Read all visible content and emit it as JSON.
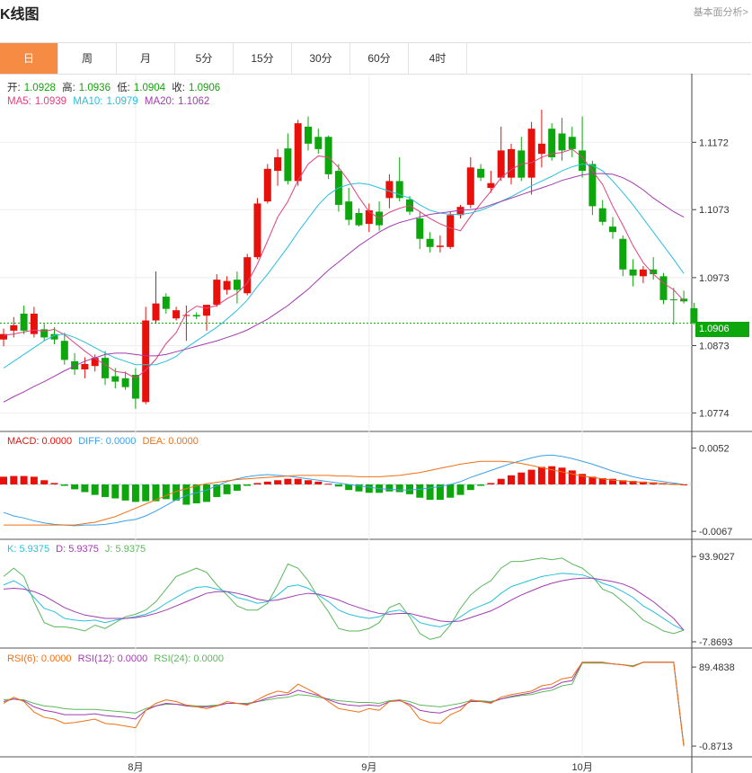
{
  "header": {
    "title": "K线图",
    "fundamental_link": "基本面分析>"
  },
  "tabs": [
    {
      "label": "日",
      "active": true
    },
    {
      "label": "周",
      "active": false
    },
    {
      "label": "月",
      "active": false
    },
    {
      "label": "5分",
      "active": false
    },
    {
      "label": "15分",
      "active": false
    },
    {
      "label": "30分",
      "active": false
    },
    {
      "label": "60分",
      "active": false
    },
    {
      "label": "4时",
      "active": false
    }
  ],
  "ohlc": {
    "open_label": "开:",
    "open": "1.0928",
    "high_label": "高:",
    "high": "1.0936",
    "low_label": "低:",
    "low": "1.0904",
    "close_label": "收:",
    "close": "1.0906"
  },
  "ma": {
    "ma5_label": "MA5:",
    "ma5": "1.0939",
    "ma10_label": "MA10:",
    "ma10": "1.0979",
    "ma20_label": "MA20:",
    "ma20": "1.1062"
  },
  "macd": {
    "macd_label": "MACD: 0.0000",
    "diff_label": "DIFF: 0.0000",
    "dea_label": "DEA: 0.0000"
  },
  "kdj": {
    "k_label": "K: 5.9375",
    "d_label": "D: 5.9375",
    "j_label": "J: 5.9375"
  },
  "rsi": {
    "rsi6_label": "RSI(6): 0.0000",
    "rsi12_label": "RSI(12): 0.0000",
    "rsi24_label": "RSI(24): 0.0000"
  },
  "current_price": "1.0906",
  "colors": {
    "up": "#e8100a",
    "down": "#0da70d",
    "ma5": "#e0407f",
    "ma10": "#28c0dc",
    "ma20": "#a33bb0",
    "diff": "#3ba0e8",
    "dea": "#f07014",
    "rsi6": "#f07014",
    "rsi12": "#a33bb0",
    "rsi24": "#5cb85c",
    "tab_active": "#f68b43"
  },
  "chart_data": {
    "type": "candlestick",
    "price_axis_ticks": [
      "1.1172",
      "1.1073",
      "1.0973",
      "1.0873",
      "1.0774"
    ],
    "price_range": [
      1.076,
      1.122
    ],
    "x_tick_labels": [
      {
        "label": "8月",
        "index": 13
      },
      {
        "label": "9月",
        "index": 36
      },
      {
        "label": "10月",
        "index": 57
      }
    ],
    "candles": [
      [
        1.0882,
        1.0898,
        1.0872,
        1.089
      ],
      [
        1.0895,
        1.0915,
        1.0885,
        1.0903
      ],
      [
        1.092,
        1.0932,
        1.089,
        1.0895
      ],
      [
        1.089,
        1.093,
        1.0885,
        1.092
      ],
      [
        1.0897,
        1.0905,
        1.088,
        1.0885
      ],
      [
        1.089,
        1.09,
        1.0875,
        1.0882
      ],
      [
        1.088,
        1.0892,
        1.0845,
        1.0852
      ],
      [
        1.085,
        1.0862,
        1.083,
        1.0838
      ],
      [
        1.0838,
        1.0856,
        1.0825,
        1.0846
      ],
      [
        1.0843,
        1.086,
        1.0835,
        1.0855
      ],
      [
        1.0855,
        1.0865,
        1.0815,
        1.0825
      ],
      [
        1.0828,
        1.084,
        1.081,
        1.082
      ],
      [
        1.0825,
        1.0835,
        1.0808,
        1.0812
      ],
      [
        1.083,
        1.084,
        1.078,
        1.0795
      ],
      [
        1.079,
        1.093,
        1.0787,
        1.091
      ],
      [
        1.091,
        1.0982,
        1.0905,
        1.0935
      ],
      [
        1.0945,
        1.095,
        1.092,
        1.0927
      ],
      [
        1.0913,
        1.093,
        1.091,
        1.0925
      ],
      [
        1.0917,
        1.0932,
        1.088,
        1.0918
      ],
      [
        1.0918,
        1.0922,
        1.0912,
        1.0916
      ],
      [
        1.0917,
        1.093,
        1.0895,
        1.0933
      ],
      [
        1.0933,
        1.0978,
        1.093,
        1.097
      ],
      [
        1.0955,
        1.0975,
        1.0948,
        1.0968
      ],
      [
        1.097,
        1.0982,
        1.0935,
        1.0955
      ],
      [
        1.095,
        1.1008,
        1.0947,
        1.1003
      ],
      [
        1.1003,
        1.109,
        1.1,
        1.1082
      ],
      [
        1.1085,
        1.114,
        1.1082,
        1.1133
      ],
      [
        1.113,
        1.1162,
        1.1108,
        1.115
      ],
      [
        1.1163,
        1.1185,
        1.111,
        1.1115
      ],
      [
        1.1115,
        1.1205,
        1.1108,
        1.12
      ],
      [
        1.1195,
        1.121,
        1.116,
        1.117
      ],
      [
        1.118,
        1.1192,
        1.1155,
        1.1162
      ],
      [
        1.118,
        1.1182,
        1.1118,
        1.1125
      ],
      [
        1.113,
        1.114,
        1.107,
        1.108
      ],
      [
        1.1085,
        1.1105,
        1.105,
        1.1058
      ],
      [
        1.1068,
        1.1075,
        1.1048,
        1.105
      ],
      [
        1.1052,
        1.1082,
        1.104,
        1.1072
      ],
      [
        1.107,
        1.1085,
        1.1042,
        1.105
      ],
      [
        1.109,
        1.1125,
        1.1075,
        1.1115
      ],
      [
        1.1115,
        1.115,
        1.1085,
        1.109
      ],
      [
        1.1088,
        1.1093,
        1.1065,
        1.107
      ],
      [
        1.106,
        1.107,
        1.1015,
        1.103
      ],
      [
        1.103,
        1.104,
        1.101,
        1.1018
      ],
      [
        1.1018,
        1.1035,
        1.101,
        1.102
      ],
      [
        1.1018,
        1.107,
        1.1015,
        1.1065
      ],
      [
        1.1065,
        1.108,
        1.106,
        1.1077
      ],
      [
        1.108,
        1.115,
        1.1075,
        1.1135
      ],
      [
        1.1133,
        1.114,
        1.1115,
        1.112
      ],
      [
        1.1105,
        1.113,
        1.1098,
        1.1112
      ],
      [
        1.112,
        1.1195,
        1.1115,
        1.116
      ],
      [
        1.112,
        1.117,
        1.111,
        1.1162
      ],
      [
        1.116,
        1.118,
        1.1115,
        1.112
      ],
      [
        1.112,
        1.1202,
        1.1095,
        1.1192
      ],
      [
        1.1155,
        1.122,
        1.1135,
        1.117
      ],
      [
        1.1192,
        1.12,
        1.1145,
        1.115
      ],
      [
        1.1185,
        1.1208,
        1.1145,
        1.116
      ],
      [
        1.118,
        1.1195,
        1.115,
        1.1162
      ],
      [
        1.116,
        1.121,
        1.112,
        1.113
      ],
      [
        1.114,
        1.1145,
        1.1065,
        1.1078
      ],
      [
        1.1075,
        1.1087,
        1.105,
        1.1055
      ],
      [
        1.1048,
        1.1062,
        1.103,
        1.104
      ],
      [
        1.103,
        1.1035,
        1.0975,
        1.0985
      ],
      [
        1.0985,
        1.1,
        1.096,
        1.0976
      ],
      [
        1.0975,
        1.099,
        1.0965,
        1.0985
      ],
      [
        1.0985,
        1.1003,
        1.097,
        1.0978
      ],
      [
        1.0975,
        1.098,
        1.0934,
        1.094
      ],
      [
        1.0941,
        1.0958,
        1.0904,
        1.094
      ],
      [
        1.0942,
        1.0954,
        1.0935,
        1.0938
      ],
      [
        1.0928,
        1.0936,
        1.0904,
        1.0906
      ]
    ],
    "ma5": [
      1.0888,
      1.089,
      1.0893,
      1.0896,
      1.0894,
      1.0897,
      1.0889,
      1.0877,
      1.0865,
      1.0854,
      1.0845,
      1.0835,
      1.0833,
      1.0825,
      1.0837,
      1.0853,
      1.0876,
      1.0892,
      1.0921,
      1.0931,
      1.0928,
      1.0932,
      1.0942,
      1.095,
      1.0965,
      1.0993,
      1.1027,
      1.1062,
      1.1085,
      1.1116,
      1.114,
      1.1152,
      1.115,
      1.1135,
      1.1115,
      1.1091,
      1.107,
      1.106,
      1.1069,
      1.1075,
      1.1079,
      1.107,
      1.106,
      1.1052,
      1.1046,
      1.1042,
      1.1063,
      1.1082,
      1.11,
      1.112,
      1.1132,
      1.114,
      1.1142,
      1.115,
      1.1155,
      1.1157,
      1.1162,
      1.115,
      1.113,
      1.111,
      1.1078,
      1.105,
      1.102,
      1.0995,
      1.0978,
      1.0965,
      1.0955,
      1.0939
    ],
    "ma10": [
      1.084,
      1.085,
      1.086,
      1.087,
      1.088,
      1.0888,
      1.089,
      1.0885,
      1.0878,
      1.087,
      1.0862,
      1.0855,
      1.085,
      1.0845,
      1.0845,
      1.0845,
      1.085,
      1.0857,
      1.087,
      1.088,
      1.089,
      1.09,
      1.0912,
      1.0925,
      1.094,
      1.096,
      1.0978,
      1.0998,
      1.1018,
      1.104,
      1.106,
      1.108,
      1.1095,
      1.1105,
      1.111,
      1.1112,
      1.111,
      1.1105,
      1.11,
      1.1095,
      1.109,
      1.108,
      1.1072,
      1.1068,
      1.1066,
      1.1066,
      1.1068,
      1.1072,
      1.1078,
      1.1085,
      1.1092,
      1.11,
      1.1108,
      1.1115,
      1.1122,
      1.113,
      1.1136,
      1.114,
      1.1138,
      1.113,
      1.1115,
      1.1098,
      1.108,
      1.106,
      1.104,
      1.102,
      1.1,
      1.0979
    ],
    "ma20": [
      1.079,
      1.0798,
      1.0805,
      1.0813,
      1.082,
      1.0828,
      1.0836,
      1.0843,
      1.085,
      1.0855,
      1.086,
      1.0862,
      1.0862,
      1.086,
      1.0858,
      1.0858,
      1.086,
      1.0864,
      1.0868,
      1.0872,
      1.0876,
      1.088,
      1.0885,
      1.089,
      1.0896,
      1.0904,
      1.0912,
      1.0922,
      1.0932,
      1.0944,
      1.0956,
      1.097,
      1.0984,
      1.0996,
      1.1008,
      1.102,
      1.103,
      1.104,
      1.1048,
      1.1054,
      1.1058,
      1.1062,
      1.1066,
      1.1068,
      1.107,
      1.1072,
      1.1073,
      1.1075,
      1.108,
      1.1085,
      1.109,
      1.1095,
      1.11,
      1.1105,
      1.111,
      1.1116,
      1.112,
      1.1124,
      1.1126,
      1.1126,
      1.1125,
      1.112,
      1.1112,
      1.1102,
      1.109,
      1.108,
      1.107,
      1.1062
    ],
    "macd_axis_ticks": [
      "0.0052",
      "-0.0067"
    ],
    "macd_range": [
      -0.0072,
      0.0068
    ],
    "macd_hist": [
      0.0011,
      0.0012,
      0.0012,
      0.0011,
      0.0006,
      0.0002,
      -0.0002,
      -0.0007,
      -0.0011,
      -0.0015,
      -0.0018,
      -0.002,
      -0.0023,
      -0.0025,
      -0.0024,
      -0.0024,
      -0.0021,
      -0.0023,
      -0.0029,
      -0.0027,
      -0.0025,
      -0.0018,
      -0.0014,
      -0.0009,
      -0.0002,
      0.0002,
      0.0004,
      0.0006,
      0.0008,
      0.0008,
      0.0006,
      0.0004,
      0.0001,
      -0.0003,
      -0.0008,
      -0.001,
      -0.0012,
      -0.0012,
      -0.001,
      -0.0011,
      -0.0014,
      -0.0019,
      -0.0022,
      -0.0022,
      -0.0019,
      -0.0015,
      -0.0008,
      -0.0002,
      0.0002,
      0.0008,
      0.0013,
      0.0017,
      0.0021,
      0.0025,
      0.0026,
      0.0024,
      0.002,
      0.0015,
      0.0011,
      0.0009,
      0.0008,
      0.0006,
      0.0005,
      0.0004,
      0.0003,
      0.0002,
      0.0001,
      0.0
    ],
    "macd_diff": [
      -0.004,
      -0.0045,
      -0.0048,
      -0.0052,
      -0.0055,
      -0.0057,
      -0.0058,
      -0.0059,
      -0.0058,
      -0.0058,
      -0.0057,
      -0.0055,
      -0.0052,
      -0.005,
      -0.0045,
      -0.0038,
      -0.003,
      -0.0022,
      -0.0016,
      -0.0012,
      -0.0008,
      -0.0002,
      0.0004,
      0.0008,
      0.0011,
      0.0013,
      0.0014,
      0.0013,
      0.0012,
      0.001,
      0.0008,
      0.0006,
      0.0004,
      0.0002,
      0.0,
      -0.0002,
      -0.0004,
      -0.0006,
      -0.0007,
      -0.0008,
      -0.0008,
      -0.0007,
      -0.0005,
      -0.0003,
      0.0,
      0.0004,
      0.001,
      0.0015,
      0.002,
      0.0025,
      0.003,
      0.0034,
      0.0038,
      0.0041,
      0.0042,
      0.004,
      0.0037,
      0.0033,
      0.0029,
      0.0024,
      0.0019,
      0.0015,
      0.0011,
      0.0008,
      0.0006,
      0.0004,
      0.0002,
      0.0
    ],
    "macd_dea": [
      -0.0058,
      -0.0058,
      -0.0058,
      -0.0058,
      -0.0058,
      -0.0058,
      -0.0058,
      -0.0058,
      -0.0056,
      -0.0054,
      -0.005,
      -0.0046,
      -0.004,
      -0.0034,
      -0.0028,
      -0.0022,
      -0.0016,
      -0.001,
      -0.0006,
      -0.0002,
      0.0001,
      0.0003,
      0.0005,
      0.0007,
      0.0008,
      0.0009,
      0.001,
      0.0011,
      0.0012,
      0.0013,
      0.0013,
      0.0013,
      0.0013,
      0.0012,
      0.0012,
      0.0011,
      0.0011,
      0.0011,
      0.0012,
      0.0013,
      0.0015,
      0.0017,
      0.002,
      0.0023,
      0.0026,
      0.0029,
      0.0031,
      0.0033,
      0.0033,
      0.0033,
      0.0032,
      0.003,
      0.0027,
      0.0024,
      0.0021,
      0.0018,
      0.0015,
      0.0012,
      0.001,
      0.0008,
      0.0006,
      0.0005,
      0.0004,
      0.0003,
      0.0002,
      0.0001,
      0.0,
      0.0
    ],
    "kdj_axis_ticks": [
      "93.9027",
      "-7.8693"
    ],
    "kdj_range": [
      -10,
      108
    ],
    "kdj_k": [
      60,
      65,
      58,
      45,
      32,
      28,
      20,
      18,
      17,
      18,
      15,
      18,
      20,
      22,
      25,
      30,
      38,
      45,
      52,
      57,
      58,
      55,
      52,
      45,
      42,
      38,
      40,
      48,
      58,
      60,
      56,
      48,
      40,
      30,
      25,
      22,
      20,
      22,
      28,
      30,
      25,
      15,
      12,
      10,
      14,
      22,
      30,
      35,
      40,
      50,
      58,
      62,
      66,
      70,
      72,
      74,
      73,
      72,
      68,
      62,
      58,
      52,
      45,
      35,
      28,
      20,
      12,
      5.9375
    ],
    "kdj_d": [
      55,
      56,
      55,
      52,
      47,
      40,
      33,
      28,
      24,
      22,
      20,
      20,
      20,
      21,
      23,
      26,
      30,
      35,
      40,
      45,
      50,
      52,
      52,
      50,
      47,
      43,
      41,
      42,
      45,
      48,
      50,
      49,
      46,
      42,
      37,
      33,
      29,
      26,
      25,
      26,
      26,
      23,
      20,
      17,
      16,
      17,
      21,
      25,
      29,
      35,
      42,
      48,
      53,
      58,
      62,
      65,
      67,
      68,
      68,
      66,
      64,
      61,
      56,
      48,
      40,
      30,
      20,
      5.9375
    ],
    "kdj_j": [
      70,
      80,
      70,
      40,
      15,
      10,
      10,
      8,
      5,
      12,
      8,
      15,
      22,
      25,
      30,
      40,
      55,
      70,
      75,
      80,
      75,
      60,
      48,
      35,
      30,
      30,
      38,
      60,
      85,
      80,
      65,
      45,
      28,
      8,
      5,
      5,
      8,
      15,
      33,
      38,
      22,
      2,
      -5,
      -2,
      12,
      32,
      48,
      58,
      65,
      80,
      88,
      88,
      90,
      92,
      90,
      92,
      85,
      80,
      70,
      55,
      50,
      40,
      30,
      18,
      12,
      5,
      2,
      5.9375
    ],
    "rsi_axis_ticks": [
      "89.4838",
      "-0.8713"
    ],
    "rsi_range": [
      -8,
      105
    ],
    "rsi6": [
      48,
      55,
      50,
      38,
      32,
      30,
      25,
      26,
      28,
      30,
      25,
      24,
      22,
      20,
      40,
      48,
      52,
      50,
      46,
      44,
      42,
      45,
      50,
      48,
      46,
      52,
      58,
      62,
      60,
      70,
      64,
      58,
      50,
      42,
      40,
      38,
      42,
      40,
      50,
      52,
      45,
      30,
      26,
      25,
      35,
      40,
      52,
      50,
      48,
      55,
      58,
      60,
      62,
      68,
      70,
      76,
      78,
      95,
      95,
      95,
      93,
      92,
      90,
      95,
      95,
      95,
      95,
      -0.8713
    ],
    "rsi12": [
      50,
      53,
      51,
      44,
      40,
      38,
      35,
      35,
      35,
      36,
      34,
      33,
      32,
      30,
      40,
      45,
      48,
      47,
      45,
      44,
      44,
      45,
      48,
      48,
      47,
      50,
      54,
      57,
      58,
      63,
      60,
      57,
      52,
      48,
      46,
      45,
      46,
      45,
      50,
      51,
      47,
      40,
      38,
      37,
      41,
      44,
      50,
      50,
      49,
      53,
      56,
      58,
      60,
      64,
      66,
      72,
      74,
      95,
      95,
      95,
      93,
      92,
      90,
      95,
      95,
      95,
      95,
      -0.8713
    ],
    "rsi24": [
      52,
      53,
      52,
      48,
      45,
      44,
      42,
      41,
      41,
      41,
      40,
      39,
      38,
      37,
      42,
      45,
      47,
      47,
      46,
      45,
      45,
      46,
      48,
      48,
      48,
      50,
      52,
      54,
      55,
      58,
      57,
      55,
      53,
      51,
      50,
      49,
      49,
      48,
      51,
      52,
      50,
      46,
      45,
      44,
      46,
      48,
      51,
      51,
      50,
      53,
      55,
      57,
      58,
      61,
      63,
      68,
      70,
      94,
      94,
      94,
      93,
      92,
      91,
      95,
      95,
      95,
      95,
      -0.8713
    ]
  }
}
